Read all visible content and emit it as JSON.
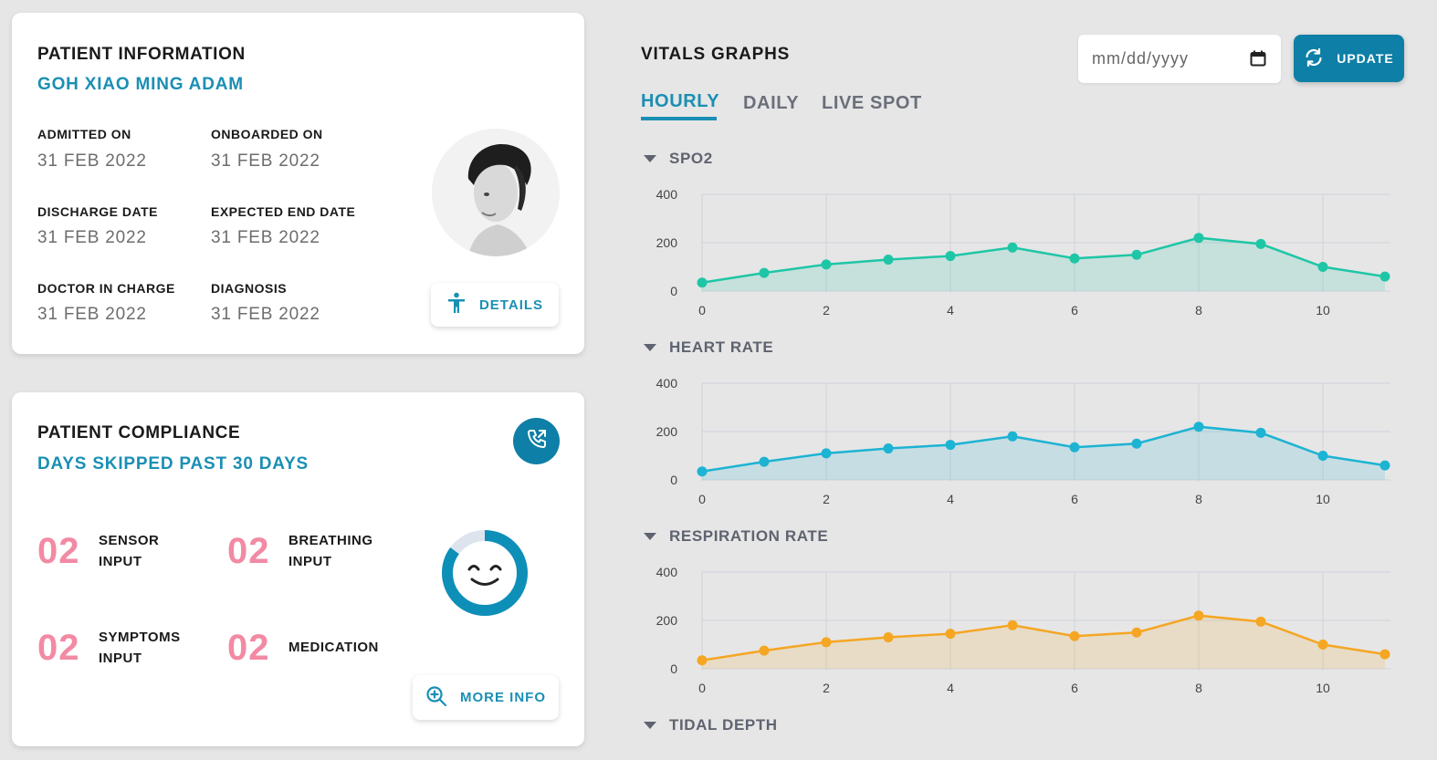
{
  "patient_info": {
    "title": "PATIENT INFORMATION",
    "name": "GOH XIAO MING ADAM",
    "fields": [
      {
        "label": "ADMITTED ON",
        "value": "31 FEB 2022"
      },
      {
        "label": "ONBOARDED ON",
        "value": "31 FEB 2022"
      },
      {
        "label": "DISCHARGE DATE",
        "value": "31 FEB 2022"
      },
      {
        "label": "EXPECTED END DATE",
        "value": "31 FEB 2022"
      },
      {
        "label": "DOCTOR IN CHARGE",
        "value": "31 FEB 2022"
      },
      {
        "label": "DIAGNOSIS",
        "value": "31 FEB 2022"
      }
    ],
    "details_button": "DETAILS",
    "details_icon": "accessibility-person-icon"
  },
  "compliance": {
    "title": "PATIENT COMPLIANCE",
    "subtitle": "DAYS SKIPPED PAST 30 DAYS",
    "call_icon": "phone-outgoing-icon",
    "items": [
      {
        "number": "02",
        "label1": "SENSOR",
        "label2": "INPUT"
      },
      {
        "number": "02",
        "label1": "BREATHING",
        "label2": "INPUT"
      },
      {
        "number": "02",
        "label1": "SYMPTOMS",
        "label2": "INPUT"
      },
      {
        "number": "02",
        "label1": "MEDICATION",
        "label2": ""
      }
    ],
    "gauge_fraction": 0.85,
    "gauge_icon": "smiley-face-icon",
    "more_info_button": "MORE INFO",
    "more_info_icon": "zoom-in-icon"
  },
  "vitals": {
    "title": "VITALS GRAPHS",
    "tabs": [
      "HOURLY",
      "DAILY",
      "LIVE SPOT"
    ],
    "active_tab": "HOURLY",
    "date_placeholder": "mm/dd/yyyy",
    "update_button": "UPDATE",
    "sections": [
      "SPO2",
      "HEART RATE",
      "RESPIRATION RATE",
      "TIDAL DEPTH"
    ]
  },
  "colors": {
    "accent": "#1a8fb4",
    "button_dark": "#0e7fa6",
    "pink_number": "#f28aa4",
    "spo2": "#1fc6a6",
    "heart_rate": "#1db3d3",
    "respiration": "#f5a623"
  },
  "chart_data": [
    {
      "type": "area",
      "section": "SPO2",
      "x": [
        0,
        1,
        2,
        3,
        4,
        5,
        6,
        7,
        8,
        9,
        10,
        11
      ],
      "values": [
        35,
        75,
        110,
        130,
        145,
        180,
        135,
        150,
        220,
        195,
        100,
        60
      ],
      "xticks": [
        0,
        2,
        4,
        6,
        8,
        10
      ],
      "yticks": [
        0,
        200,
        400
      ],
      "ylim": [
        0,
        400
      ],
      "grid": true,
      "color": "#1fc6a6"
    },
    {
      "type": "area",
      "section": "HEART RATE",
      "x": [
        0,
        1,
        2,
        3,
        4,
        5,
        6,
        7,
        8,
        9,
        10,
        11
      ],
      "values": [
        35,
        75,
        110,
        130,
        145,
        180,
        135,
        150,
        220,
        195,
        100,
        60
      ],
      "xticks": [
        0,
        2,
        4,
        6,
        8,
        10
      ],
      "yticks": [
        0,
        200,
        400
      ],
      "ylim": [
        0,
        400
      ],
      "grid": true,
      "color": "#1db3d3"
    },
    {
      "type": "area",
      "section": "RESPIRATION RATE",
      "x": [
        0,
        1,
        2,
        3,
        4,
        5,
        6,
        7,
        8,
        9,
        10,
        11
      ],
      "values": [
        35,
        75,
        110,
        130,
        145,
        180,
        135,
        150,
        220,
        195,
        100,
        60
      ],
      "xticks": [
        0,
        2,
        4,
        6,
        8,
        10
      ],
      "yticks": [
        0,
        200,
        400
      ],
      "ylim": [
        0,
        400
      ],
      "grid": true,
      "color": "#f5a623"
    }
  ]
}
